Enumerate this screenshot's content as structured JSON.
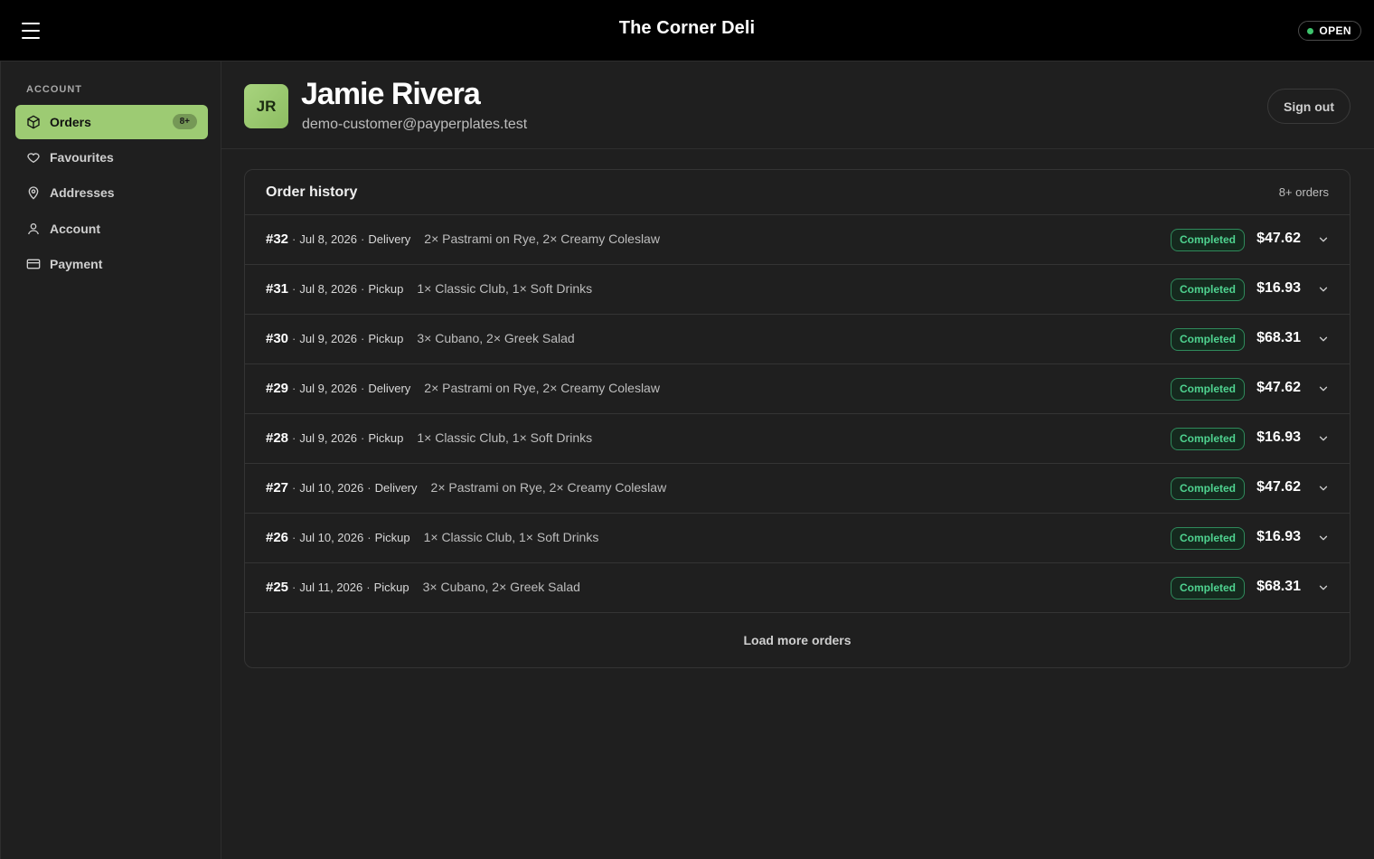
{
  "header": {
    "brand": "The Corner Deli",
    "status": "OPEN",
    "status_color": "#3ec46d"
  },
  "sidebar": {
    "heading": "ACCOUNT",
    "items": [
      {
        "label": "Orders",
        "icon": "package-icon",
        "badge": "8+",
        "active": true
      },
      {
        "label": "Favourites",
        "icon": "heart-icon"
      },
      {
        "label": "Addresses",
        "icon": "map-pin-icon"
      },
      {
        "label": "Account",
        "icon": "user-icon"
      },
      {
        "label": "Payment",
        "icon": "credit-card-icon"
      }
    ],
    "accent_color": "#9dcb73"
  },
  "profile": {
    "initials": "JR",
    "name": "Jamie Rivera",
    "email": "demo-customer@payperplates.test",
    "signout_label": "Sign out"
  },
  "orders": {
    "title": "Order history",
    "count": "8+ orders",
    "load_more": "Load more orders",
    "rows": [
      {
        "num": "#32",
        "date": "Jul 8, 2026",
        "type": "Delivery",
        "items": "2× Pastrami on Rye, 2× Creamy Coleslaw",
        "status": "Completed",
        "total": "$47.62"
      },
      {
        "num": "#31",
        "date": "Jul 8, 2026",
        "type": "Pickup",
        "items": "1× Classic Club, 1× Soft Drinks",
        "status": "Completed",
        "total": "$16.93"
      },
      {
        "num": "#30",
        "date": "Jul 9, 2026",
        "type": "Pickup",
        "items": "3× Cubano, 2× Greek Salad",
        "status": "Completed",
        "total": "$68.31"
      },
      {
        "num": "#29",
        "date": "Jul 9, 2026",
        "type": "Delivery",
        "items": "2× Pastrami on Rye, 2× Creamy Coleslaw",
        "status": "Completed",
        "total": "$47.62"
      },
      {
        "num": "#28",
        "date": "Jul 9, 2026",
        "type": "Pickup",
        "items": "1× Classic Club, 1× Soft Drinks",
        "status": "Completed",
        "total": "$16.93"
      },
      {
        "num": "#27",
        "date": "Jul 10, 2026",
        "type": "Delivery",
        "items": "2× Pastrami on Rye, 2× Creamy Coleslaw",
        "status": "Completed",
        "total": "$47.62"
      },
      {
        "num": "#26",
        "date": "Jul 10, 2026",
        "type": "Pickup",
        "items": "1× Classic Club, 1× Soft Drinks",
        "status": "Completed",
        "total": "$16.93"
      },
      {
        "num": "#25",
        "date": "Jul 11, 2026",
        "type": "Pickup",
        "items": "3× Cubano, 2× Greek Salad",
        "status": "Completed",
        "total": "$68.31"
      }
    ],
    "status_color": "#4fd390"
  }
}
